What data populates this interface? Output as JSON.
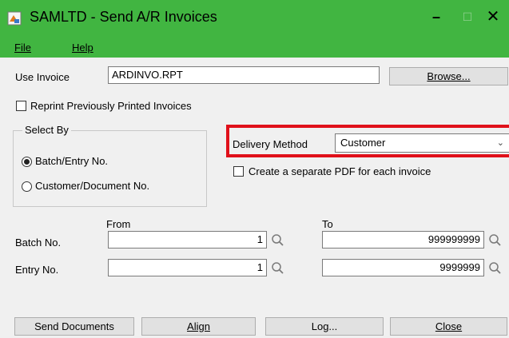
{
  "window": {
    "title": "SAMLTD - Send A/R Invoices",
    "minimize": "–",
    "maximize": "☐",
    "close": "✕"
  },
  "menu": {
    "file": "File",
    "help": "Help"
  },
  "use_invoice": {
    "label": "Use Invoice",
    "value": "ARDINVO.RPT",
    "browse": "Browse..."
  },
  "reprint": {
    "label": "Reprint Previously Printed Invoices",
    "checked": false
  },
  "select_by": {
    "legend": "Select By",
    "options": [
      {
        "label": "Batch/Entry No.",
        "selected": true
      },
      {
        "label": "Customer/Document No.",
        "selected": false
      }
    ]
  },
  "delivery": {
    "label": "Delivery Method",
    "value": "Customer"
  },
  "separate_pdf": {
    "label": "Create a separate PDF for each invoice",
    "checked": false
  },
  "range": {
    "from_label": "From",
    "to_label": "To",
    "batch": {
      "label": "Batch No.",
      "from": "1",
      "to": "999999999"
    },
    "entry": {
      "label": "Entry No.",
      "from": "1",
      "to": "9999999"
    }
  },
  "buttons": {
    "send": "Send Documents",
    "align": "Align",
    "log": "Log...",
    "close": "Close"
  },
  "colors": {
    "titlebar": "#41b541",
    "highlight": "#e0101a"
  }
}
